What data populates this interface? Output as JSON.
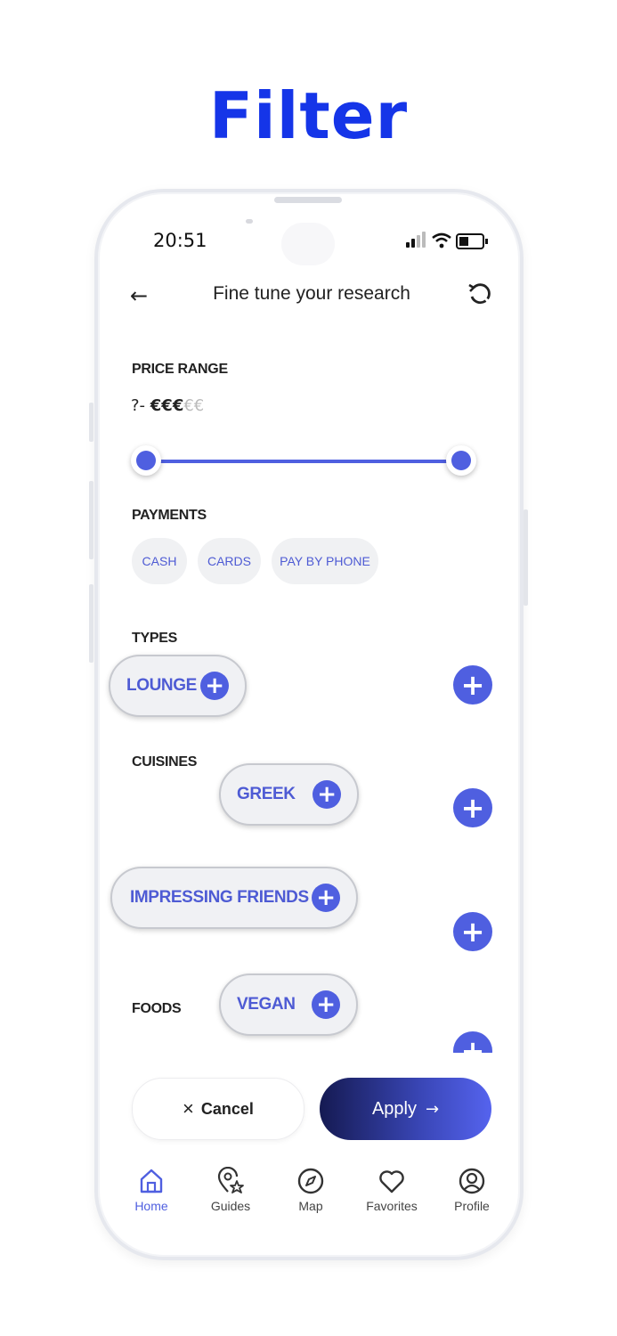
{
  "headline": "Filter",
  "status_bar": {
    "time": "20:51"
  },
  "nav": {
    "back_icon": "←",
    "title": "Fine tune your research",
    "reset_icon": "reset-icon"
  },
  "price_range": {
    "label": "PRICE RANGE",
    "value_prefix": "?- ",
    "active_symbols": "€€€",
    "inactive_symbols": "€€",
    "slider_min_fraction": 0.0,
    "slider_max_fraction": 1.0
  },
  "payments": {
    "label": "PAYMENTS",
    "options": [
      "CASH",
      "CARDS",
      "PAY BY PHONE"
    ]
  },
  "types": {
    "label": "TYPES",
    "chip": "LOUNGE"
  },
  "cuisines": {
    "label": "CUISINES",
    "chip": "GREEK"
  },
  "occasion": {
    "chip": "IMPRESSING FRIENDS"
  },
  "foods": {
    "label": "FOODS",
    "chip": "VEGAN"
  },
  "actions": {
    "cancel_icon": "×",
    "cancel": "Cancel",
    "apply": "Apply",
    "apply_icon": "→"
  },
  "tabs": [
    {
      "label": "Home",
      "icon": "home-icon",
      "active": true
    },
    {
      "label": "Guides",
      "icon": "guides-icon",
      "active": false
    },
    {
      "label": "Map",
      "icon": "compass-icon",
      "active": false
    },
    {
      "label": "Favorites",
      "icon": "heart-icon",
      "active": false
    },
    {
      "label": "Profile",
      "icon": "profile-icon",
      "active": false
    }
  ],
  "colors": {
    "headline": "#1535e8",
    "accent": "#4f5fe0",
    "apply_gradient_start": "#151a52"
  }
}
